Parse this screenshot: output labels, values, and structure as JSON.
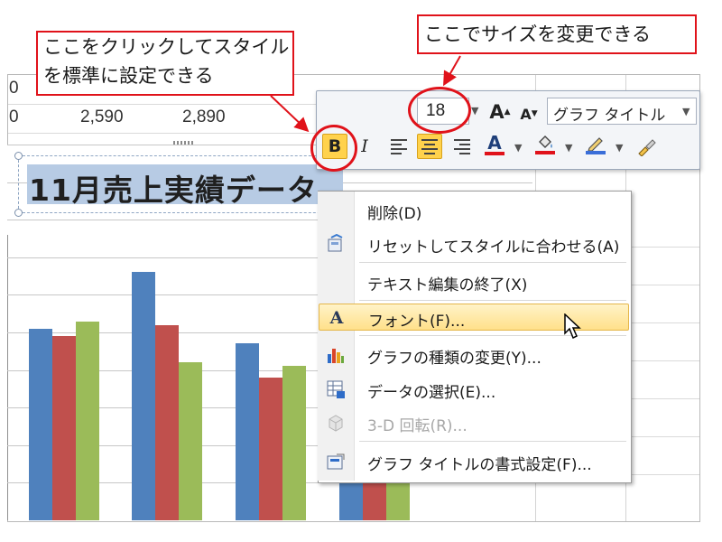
{
  "sheet": {
    "row1": [
      "0",
      "",
      ""
    ],
    "row2": [
      "0",
      "2,590",
      "2,890"
    ]
  },
  "chart": {
    "title": "11月売上実績データ",
    "handle_colors": "#7a8fab"
  },
  "chart_data": {
    "type": "bar",
    "title": "11月売上実績データ",
    "series": [
      {
        "color": "#4f81bd",
        "values": [
          51,
          66,
          47,
          40
        ]
      },
      {
        "color": "#c0504d",
        "values": [
          49,
          52,
          38,
          20
        ]
      },
      {
        "color": "#9bbb59",
        "values": [
          53,
          42,
          41,
          20
        ]
      }
    ],
    "ylim": [
      0,
      100
    ],
    "grid": true
  },
  "toolbar": {
    "font_size": "18",
    "grow_font": "A",
    "shrink_font": "A",
    "font_name": "グラフ タイトル",
    "bold": "B",
    "italic": "I",
    "font_color_letter": "A",
    "colors": {
      "font": "#e0121a",
      "fill": "#e0121a",
      "line": "#3a6ed8",
      "active": "#ffd24c"
    }
  },
  "context_menu": {
    "items": [
      {
        "label": "削除(D)",
        "icon": ""
      },
      {
        "label": "リセットしてスタイルに合わせる(A)",
        "icon": "reset-style-icon"
      },
      {
        "label": "テキスト編集の終了(X)",
        "icon": ""
      },
      {
        "label": "フォント(F)...",
        "icon": "font-icon"
      },
      {
        "label": "グラフの種類の変更(Y)...",
        "icon": "chart-type-icon"
      },
      {
        "label": "データの選択(E)...",
        "icon": "select-data-icon"
      },
      {
        "label": "3-D 回転(R)...",
        "icon": "rotation-3d-icon"
      },
      {
        "label": "グラフ タイトルの書式設定(F)...",
        "icon": "format-title-icon"
      }
    ],
    "font_icon_letter": "A"
  },
  "callouts": {
    "left": [
      "ここをクリックしてスタイル",
      "を標準に設定できる"
    ],
    "top": "ここでサイズを変更できる",
    "color": "#e0121a"
  }
}
